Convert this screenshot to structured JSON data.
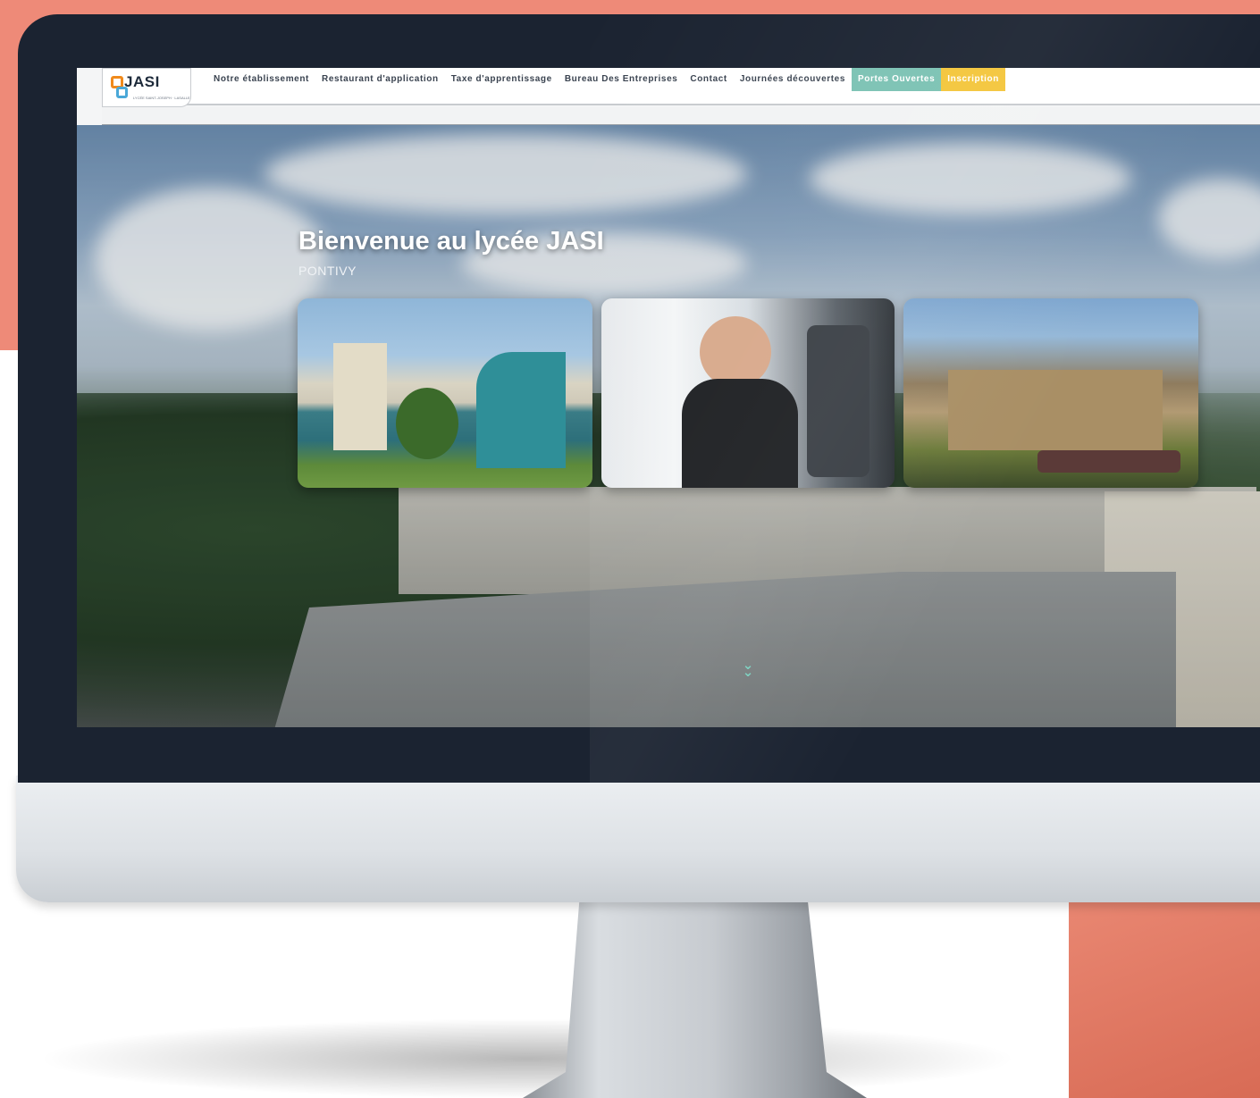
{
  "logo": {
    "text": "JASI",
    "subtitle": "LYCÉE SAINT-JOSEPH · LASALLE"
  },
  "nav": {
    "items": [
      "Notre établissement",
      "Restaurant d'application",
      "Taxe d'apprentissage",
      "Bureau Des Entreprises",
      "Contact",
      "Journées découvertes"
    ],
    "cta_green": "Portes Ouvertes",
    "cta_yellow": "Inscription"
  },
  "hero": {
    "title": "Bienvenue au lycée JASI",
    "subtitle": "PONTIVY"
  },
  "colors": {
    "coral": "#ee8a78",
    "bezel": "#1b2331",
    "cta_green": "#7bc2b3",
    "cta_yellow": "#f4c53a",
    "scroll_cue": "#7bd0bf"
  },
  "icons": {
    "scroll": "chevron-double-down-icon",
    "logo": "jasi-logo-icon"
  }
}
